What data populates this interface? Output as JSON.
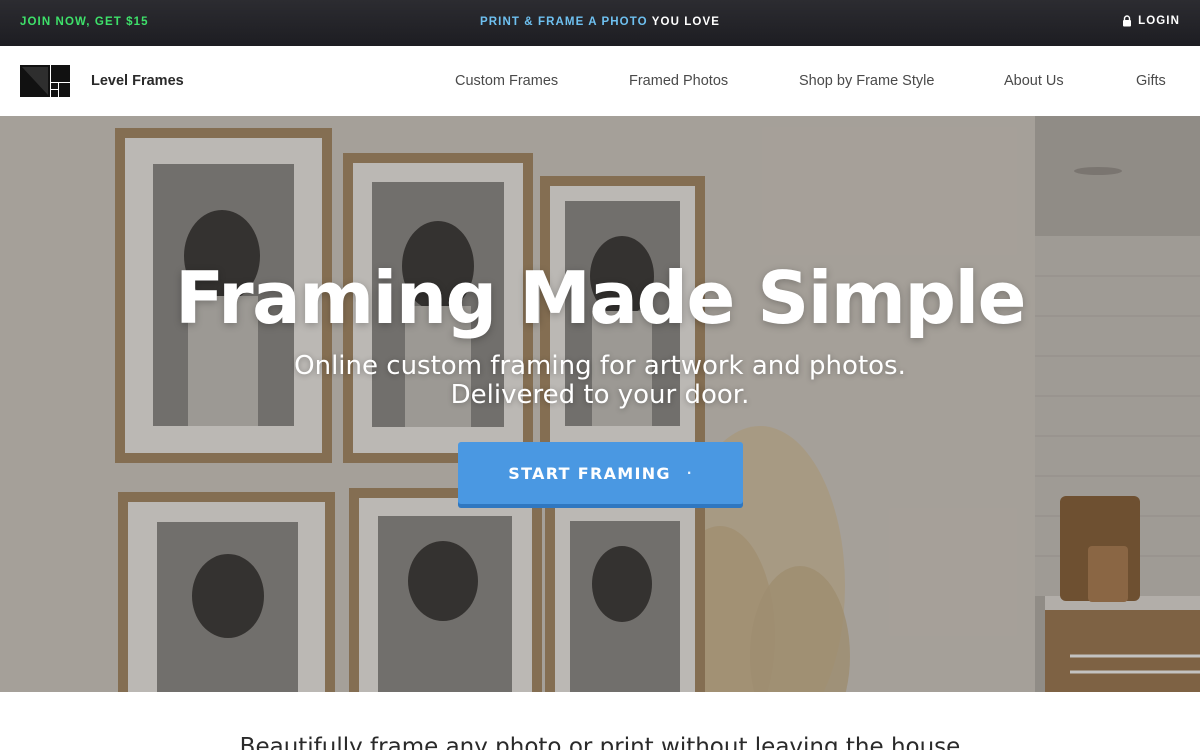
{
  "promo": {
    "join_label": "JOIN NOW, GET $15",
    "center_accent": "PRINT & FRAME A PHOTO",
    "center_rest": "YOU LOVE",
    "login_label": "LOGIN",
    "login_icon": "lock-icon"
  },
  "header": {
    "brand": "Level Frames",
    "logo_icon": "level-frames-logo",
    "nav": [
      {
        "label": "Custom Frames"
      },
      {
        "label": "Framed Photos"
      },
      {
        "label": "Shop by Frame Style"
      },
      {
        "label": "About Us"
      },
      {
        "label": "Gifts"
      }
    ]
  },
  "hero": {
    "title": "Framing Made Simple",
    "subtitle_line1": "Online custom framing for artwork and photos.",
    "subtitle_line2": "Delivered to your door.",
    "cta_label": "START FRAMING",
    "cta_suffix": "·"
  },
  "intro": {
    "text": "Beautifully frame any photo or print without leaving the house"
  },
  "colors": {
    "promo_bg": "#1d1d22",
    "join_green": "#3ee06a",
    "promo_accent_blue": "#6ec0f0",
    "cta_blue": "#4a98e2"
  }
}
